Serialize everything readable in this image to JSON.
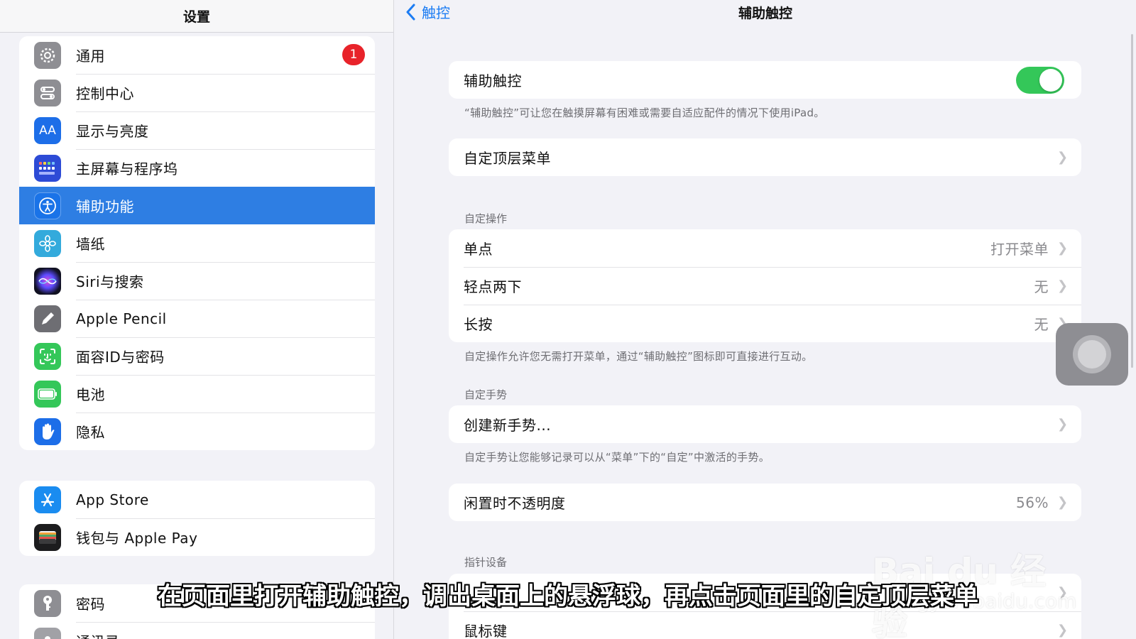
{
  "left": {
    "title": "设置",
    "groups": [
      [
        {
          "label": "通用",
          "icon": "gear-icon",
          "color": "#8e8e93",
          "badge": "1"
        },
        {
          "label": "控制中心",
          "icon": "control-center-icon",
          "color": "#8e8e93"
        },
        {
          "label": "显示与亮度",
          "icon": "display-aa-icon",
          "color": "#1d6ee8",
          "glyph": "AA"
        },
        {
          "label": "主屏幕与程序坞",
          "icon": "home-screen-icon",
          "color": "#2d4bd6"
        },
        {
          "label": "辅助功能",
          "icon": "accessibility-icon",
          "color": "#1a73e8",
          "selected": true
        },
        {
          "label": "墙纸",
          "icon": "wallpaper-icon",
          "color": "#33aadc"
        },
        {
          "label": "Siri与搜索",
          "icon": "siri-icon",
          "color": "#222236"
        },
        {
          "label": "Apple Pencil",
          "icon": "pencil-icon",
          "color": "#6e6e73"
        },
        {
          "label": "面容ID与密码",
          "icon": "face-id-icon",
          "color": "#34c759"
        },
        {
          "label": "电池",
          "icon": "battery-icon",
          "color": "#34c759"
        },
        {
          "label": "隐私",
          "icon": "hand-icon",
          "color": "#1d6ee8"
        }
      ],
      [
        {
          "label": "App Store",
          "icon": "app-store-icon",
          "color": "#1a8cf0"
        },
        {
          "label": "钱包与 Apple Pay",
          "icon": "wallet-icon",
          "color": "#1c1c1e"
        }
      ],
      [
        {
          "label": "密码",
          "icon": "key-icon",
          "color": "#8e8e93"
        },
        {
          "label": "通讯录",
          "icon": "contacts-icon",
          "color": "#a1a1a6"
        }
      ]
    ]
  },
  "right": {
    "back_label": "触控",
    "title": "辅助触控",
    "assistive_row": "辅助触控",
    "assistive_note": "“辅助触控”可让您在触摸屏幕有困难或需要自适应配件的情况下使用iPad。",
    "top_menu_row": "自定顶层菜单",
    "custom_actions_header": "自定操作",
    "actions": [
      {
        "label": "单点",
        "value": "打开菜单"
      },
      {
        "label": "轻点两下",
        "value": "无"
      },
      {
        "label": "长按",
        "value": "无"
      }
    ],
    "actions_note": "自定操作允许您无需打开菜单，通过“辅助触控”图标即可直接进行互动。",
    "custom_gestures_header": "自定手势",
    "new_gesture_row": "创建新手势...",
    "gestures_note": "自定手势让您能够记录可以从“菜单”下的“自定”中激活的手势。",
    "idle_opacity_label": "闲置时不透明度",
    "idle_opacity_value": "56%",
    "pointer_header": "指针设备",
    "mouse_keys_row": "鼠标键"
  },
  "caption": "在页面里打开辅助触控，调出桌面上的悬浮球，再点击页面里的自定顶层菜单",
  "watermark": {
    "line1": "Bai du 经验",
    "line2": "jingyan.baidu.com"
  },
  "colors": {
    "accent": "#2e7ee3",
    "toggle_on": "#34c759",
    "badge": "#e8232a"
  }
}
